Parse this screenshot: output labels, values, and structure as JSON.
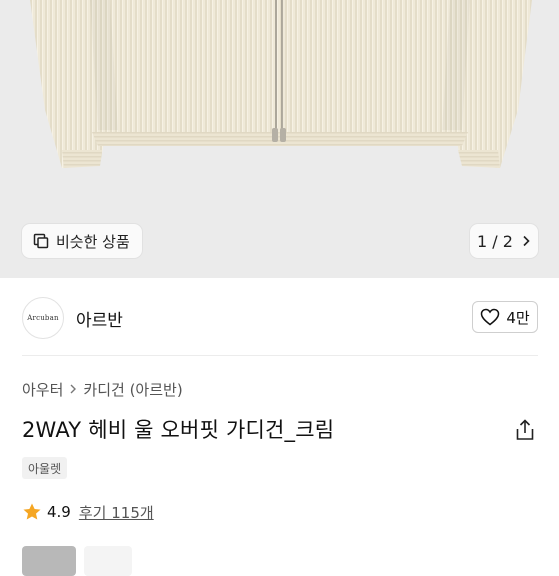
{
  "gallery": {
    "similar_label": "비슷한 상품",
    "page_indicator": "1 / 2"
  },
  "brand": {
    "logo_text": "Arcuban",
    "name": "아르반",
    "like_count": "4만"
  },
  "breadcrumb": {
    "level1": "아우터",
    "level2": "카디건 (아르반)"
  },
  "product": {
    "title": "2WAY 헤비 울 오버핏 가디건_크림",
    "tag": "아울렛"
  },
  "rating": {
    "score": "4.9",
    "reviews": "후기 115개",
    "star_color": "#f5a623"
  },
  "colors": {
    "garment": "#efe9d8",
    "gallery_bg": "#ebebeb"
  }
}
